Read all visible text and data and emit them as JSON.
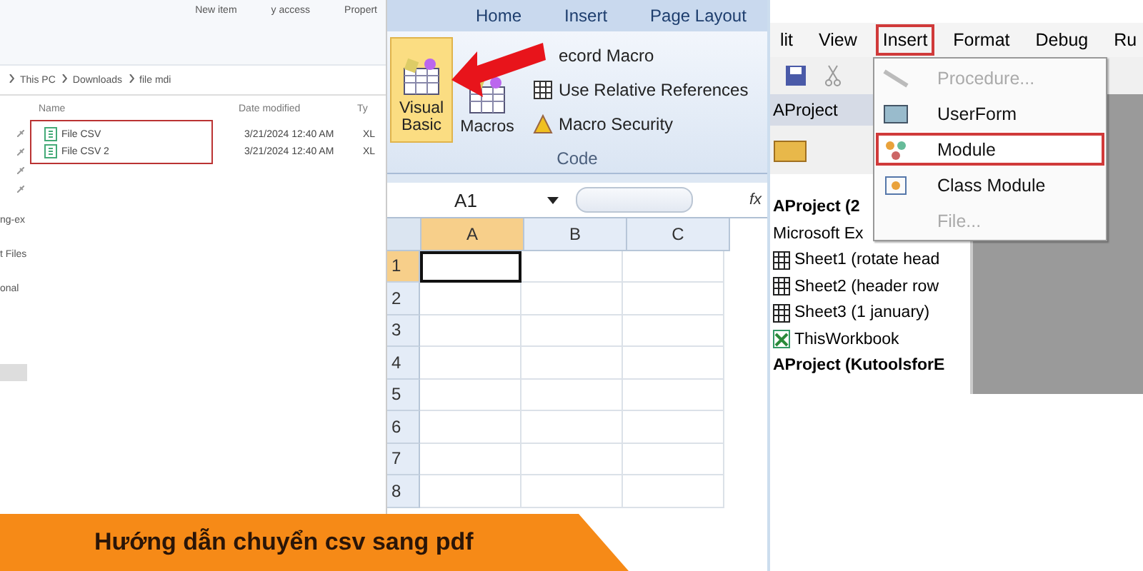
{
  "explorer": {
    "ribbon": [
      "New item",
      "y access",
      "Propert"
    ],
    "breadcrumb": [
      "This PC",
      "Downloads",
      "file mdi"
    ],
    "columns": [
      "Name",
      "Date modified",
      "Ty"
    ],
    "files": [
      {
        "name": "File CSV",
        "date": "3/21/2024 12:40 AM",
        "type": "XL"
      },
      {
        "name": "File CSV 2",
        "date": "3/21/2024 12:40 AM",
        "type": "XL"
      }
    ],
    "nav": [
      "ng-ex",
      "t Files",
      "onal"
    ]
  },
  "excel": {
    "tabs": [
      "Home",
      "Insert",
      "Page Layout"
    ],
    "big_buttons": [
      {
        "label": "Visual Basic",
        "selected": true
      },
      {
        "label": "Macros",
        "selected": false
      }
    ],
    "small_buttons": [
      "ecord Macro",
      "Use Relative References",
      "Macro Security"
    ],
    "group": "Code",
    "name_box": "A1",
    "fx": "fx",
    "columns": [
      {
        "label": "A",
        "selected": true
      },
      {
        "label": "B",
        "selected": false
      },
      {
        "label": "C",
        "selected": false
      }
    ],
    "rows": [
      {
        "label": "1",
        "selected": true
      },
      {
        "label": "2",
        "selected": false
      },
      {
        "label": "3",
        "selected": false
      },
      {
        "label": "4",
        "selected": false
      },
      {
        "label": "5",
        "selected": false
      },
      {
        "label": "6",
        "selected": false
      },
      {
        "label": "7",
        "selected": false
      },
      {
        "label": "8",
        "selected": false
      }
    ]
  },
  "vba": {
    "menu": [
      {
        "label": "lit",
        "selected": false
      },
      {
        "label": "View",
        "selected": false
      },
      {
        "label": "Insert",
        "selected": true
      },
      {
        "label": "Format",
        "selected": false
      },
      {
        "label": "Debug",
        "selected": false
      },
      {
        "label": "Ru",
        "selected": false
      }
    ],
    "pane_title": "AProject",
    "tree": [
      {
        "label": "AProject (2",
        "kind": "project"
      },
      {
        "label": "Microsoft Ex",
        "kind": "folder"
      },
      {
        "label": "Sheet1 (rotate head",
        "kind": "sheet"
      },
      {
        "label": "Sheet2 (header row",
        "kind": "sheet"
      },
      {
        "label": "Sheet3 (1 january)",
        "kind": "sheet"
      },
      {
        "label": "ThisWorkbook",
        "kind": "workbook"
      },
      {
        "label": "AProject (KutoolsforE",
        "kind": "project"
      }
    ],
    "dropdown": [
      {
        "label": "Procedure...",
        "disabled": true,
        "selected": false
      },
      {
        "label": "UserForm",
        "disabled": false,
        "selected": false
      },
      {
        "label": "Module",
        "disabled": false,
        "selected": true
      },
      {
        "label": "Class Module",
        "disabled": false,
        "selected": false
      },
      {
        "label": "File...",
        "disabled": true,
        "selected": false
      }
    ]
  },
  "banner": "Hướng dẫn chuyển csv sang pdf"
}
